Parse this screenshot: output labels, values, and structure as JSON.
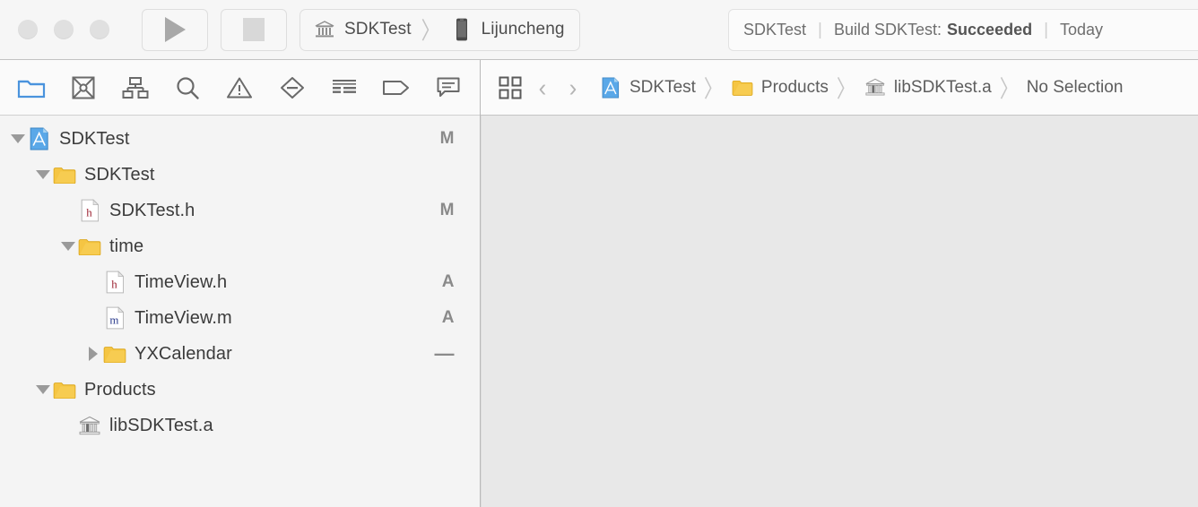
{
  "window": {
    "traffic_lights": [
      "close",
      "minimize",
      "zoom"
    ]
  },
  "toolbar": {
    "run_button_label": "Run",
    "stop_button_label": "Stop",
    "scheme": {
      "project_icon": "library-icon",
      "project_name": "SDKTest",
      "separator": "〉",
      "device_icon": "iphone-device-icon",
      "device_name": "Lijuncheng"
    },
    "status": {
      "project": "SDKTest",
      "separator": "|",
      "activity_prefix": "Build SDKTest:",
      "activity_result": "Succeeded",
      "time": "Today"
    }
  },
  "navigator": {
    "tabs": [
      {
        "name": "project-navigator",
        "icon": "folder-icon",
        "active": true
      },
      {
        "name": "source-control-navigator",
        "icon": "source-control-icon",
        "active": false
      },
      {
        "name": "symbol-navigator",
        "icon": "symbol-hierarchy-icon",
        "active": false
      },
      {
        "name": "find-navigator",
        "icon": "search-icon",
        "active": false
      },
      {
        "name": "issue-navigator",
        "icon": "warning-triangle-icon",
        "active": false
      },
      {
        "name": "test-navigator",
        "icon": "test-diamond-icon",
        "active": false
      },
      {
        "name": "debug-navigator",
        "icon": "report-list-icon",
        "active": false
      },
      {
        "name": "breakpoint-navigator",
        "icon": "breakpoint-tag-icon",
        "active": false
      },
      {
        "name": "report-navigator",
        "icon": "comment-bubble-icon",
        "active": false
      }
    ],
    "tree": [
      {
        "label": "SDKTest",
        "icon": "xcode-project-icon",
        "disclosure": "open",
        "depth": 0,
        "badge": "M"
      },
      {
        "label": "SDKTest",
        "icon": "folder-icon",
        "disclosure": "open",
        "depth": 1,
        "badge": ""
      },
      {
        "label": "SDKTest.h",
        "icon": "header-file-icon",
        "disclosure": "none",
        "depth": 2,
        "badge": "M"
      },
      {
        "label": "time",
        "icon": "folder-icon",
        "disclosure": "open",
        "depth": 2,
        "badge": ""
      },
      {
        "label": "TimeView.h",
        "icon": "header-file-icon",
        "disclosure": "none",
        "depth": 3,
        "badge": "A"
      },
      {
        "label": "TimeView.m",
        "icon": "method-file-icon",
        "disclosure": "none",
        "depth": 3,
        "badge": "A"
      },
      {
        "label": "YXCalendar",
        "icon": "folder-icon",
        "disclosure": "closed",
        "depth": 3,
        "badge": "—"
      },
      {
        "label": "Products",
        "icon": "folder-icon",
        "disclosure": "open",
        "depth": 1,
        "badge": ""
      },
      {
        "label": "libSDKTest.a",
        "icon": "library-icon",
        "disclosure": "none",
        "depth": 2,
        "badge": ""
      }
    ]
  },
  "editor": {
    "jump_bar": {
      "related_items_icon": "related-items-icon",
      "back_label": "‹",
      "forward_label": "›",
      "crumbs": [
        {
          "label": "SDKTest",
          "icon": "xcode-project-icon"
        },
        {
          "label": "Products",
          "icon": "folder-icon"
        },
        {
          "label": "libSDKTest.a",
          "icon": "library-icon"
        },
        {
          "label": "No Selection",
          "icon": ""
        }
      ],
      "separator": "〉"
    }
  },
  "colors": {
    "accent_blue": "#4a93dd",
    "folder_yellow": "#f5c543",
    "header_letter": "#9b2030",
    "method_letter": "#2a3a8c",
    "toolbar_bg": "#f6f6f6",
    "navigator_bg": "#f4f4f4",
    "editor_bg": "#e8e8e8",
    "text_gray": "#5d5d5d"
  }
}
